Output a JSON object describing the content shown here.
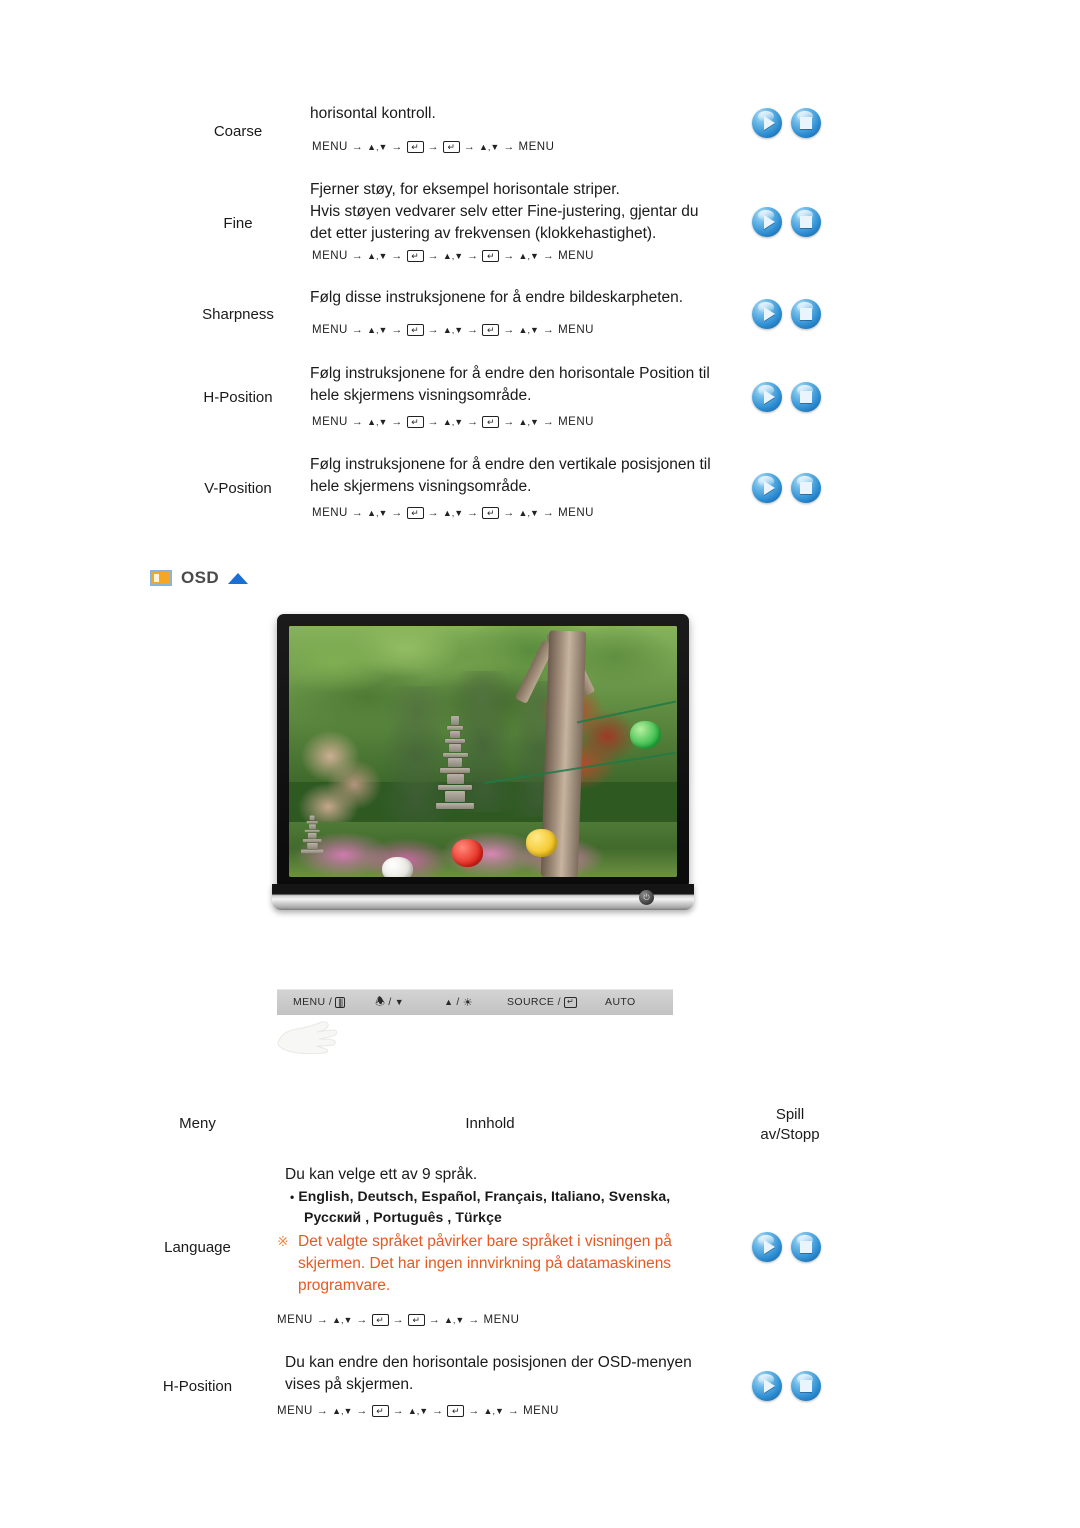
{
  "top_table": {
    "rows": [
      {
        "menu": "Coarse",
        "lines": [
          "horisontal kontroll."
        ],
        "sequence": [
          "MENU",
          "arrow",
          "updown",
          "arrow",
          "enter",
          "arrow",
          "enter",
          "arrow",
          "updown",
          "arrow",
          "MENU"
        ],
        "sequence_text": "MENU → ▲,▼ → ↵ → ↵ → ▲,▼ → MENU",
        "play_stop": [
          "play",
          "stop"
        ]
      },
      {
        "menu": "Fine",
        "lines": [
          "Fjerner støy, for eksempel horisontale striper.",
          "Hvis støyen vedvarer selv etter Fine-justering, gjentar du",
          "det etter justering av frekvensen (klokkehastighet)."
        ],
        "sequence_text": "MENU → ▲,▼ → ↵ → ▲,▼ → ↵ → ▲,▼ → MENU",
        "play_stop": [
          "play",
          "stop"
        ]
      },
      {
        "menu": "Sharpness",
        "lines": [
          "Følg disse instruksjonene for å endre bildeskarpheten."
        ],
        "sequence_text": "MENU → ▲,▼ → ↵ → ▲,▼ → ↵ → ▲,▼ → MENU",
        "play_stop": [
          "play",
          "stop"
        ]
      },
      {
        "menu": "H-Position",
        "lines": [
          "Følg instruksjonene for å endre den horisontale Position til",
          "hele skjermens visningsområde."
        ],
        "sequence_text": "MENU → ▲,▼ → ↵ → ▲,▼ → ↵ → ▲,▼ → MENU",
        "play_stop": [
          "play",
          "stop"
        ]
      },
      {
        "menu": "V-Position",
        "lines": [
          "Følg instruksjonene for å endre den vertikale posisjonen til",
          "hele skjermens visningsområde."
        ],
        "sequence_text": "MENU → ▲,▼ → ↵ → ▲,▼ → ↵ → ▲,▼ → MENU",
        "play_stop": [
          "play",
          "stop"
        ]
      }
    ]
  },
  "section": {
    "icon": "osd-panel-icon",
    "title": "OSD",
    "top_arrow": "up-triangle-icon",
    "accent_orange": "#f5a623",
    "accent_blue": "#1a6fd4"
  },
  "monitor": {
    "power_glyph": "power-icon",
    "scene_alt": "garden-with-stone-pagodas-and-paper-lanterns"
  },
  "control_bar": {
    "buttons": [
      {
        "label": "MENU /",
        "glyph": "menu-bars-icon",
        "glyph_text": "▯▯▯"
      },
      {
        "label": "/",
        "glyph": "volume-down-icon",
        "glyph_text": "▼",
        "prefix_glyph": "speaker-icon"
      },
      {
        "label": "/",
        "glyph": "brightness-icon",
        "glyph_text": "☀",
        "prefix_glyph": "up-arrow-icon"
      },
      {
        "label": "SOURCE /",
        "glyph": "enter-key-icon",
        "glyph_text": "↵"
      },
      {
        "label": "AUTO",
        "glyph": ""
      }
    ],
    "hand_icon": "pointing-hand-icon"
  },
  "bottom_table": {
    "headers": {
      "menu": "Meny",
      "content": "Innhold",
      "playstop_line1": "Spill",
      "playstop_line2": "av/Stopp"
    },
    "rows": [
      {
        "menu": "Language",
        "intro": "Du kan velge ett av 9 språk.",
        "languages_line1": "English, Deutsch, Español, Français,  Italiano, Svenska,",
        "languages_line2": "Русский , Português , Türkçe",
        "note_mark": "※",
        "note_lines": [
          "Det valgte språket påvirker bare språket i visningen på",
          "skjermen. Det har ingen innvirkning på datamaskinens",
          "programvare."
        ],
        "sequence_text": "MENU → ▲,▼ → ↵ → ↵ → ▲,▼ → MENU",
        "play_stop": [
          "play",
          "stop"
        ]
      },
      {
        "menu": "H-Position",
        "lines": [
          "Du kan endre den horisontale posisjonen der OSD-menyen",
          "vises på skjermen."
        ],
        "sequence_text": "MENU → ▲,▼ → ↵ → ▲,▼ → ↵ → ▲,▼ → MENU",
        "play_stop": [
          "play",
          "stop"
        ]
      }
    ]
  }
}
